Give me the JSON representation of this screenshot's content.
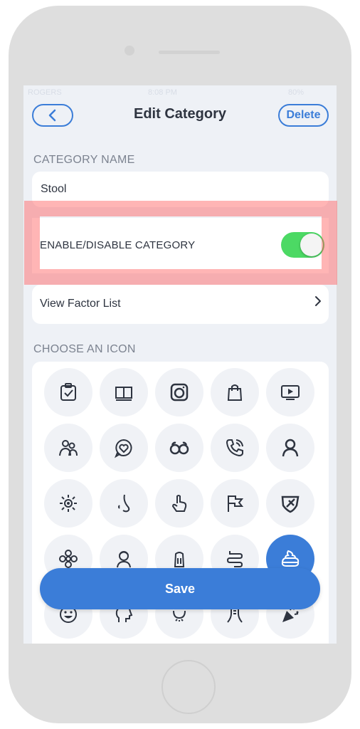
{
  "status_bar": {
    "carrier": "ROGERS",
    "time": "8:08 PM",
    "battery": "80%"
  },
  "header": {
    "back_icon": "chevron-left-icon",
    "title": "Edit Category",
    "delete_label": "Delete"
  },
  "category_name": {
    "section_label": "CATEGORY NAME",
    "value": "Stool"
  },
  "enable_toggle": {
    "label": "ENABLE/DISABLE CATEGORY",
    "enabled": true,
    "on_color": "#4cd964"
  },
  "factor_list": {
    "label": "View Factor List"
  },
  "icon_section": {
    "label": "CHOOSE AN ICON",
    "icons": [
      "checklist-icon",
      "book-icon",
      "camera-icon",
      "shopping-bag-icon",
      "tv-icon",
      "people-icon",
      "heart-chat-icon",
      "glasses-icon",
      "phone-icon",
      "person-icon",
      "sun-icon",
      "nose-icon",
      "hand-pointer-icon",
      "flag-icon",
      "shield-icon",
      "flower-icon",
      "woman-icon",
      "salt-shaker-icon",
      "intestine-icon",
      "stool-icon",
      "smiley-icon",
      "head-icon",
      "nose-face-icon",
      "throat-icon",
      "party-popper-icon"
    ],
    "selected": "stool-icon"
  },
  "save_label": "Save",
  "colors": {
    "accent": "#3b7dd8",
    "background": "#eef1f6",
    "highlight": "#ff5a5a"
  }
}
